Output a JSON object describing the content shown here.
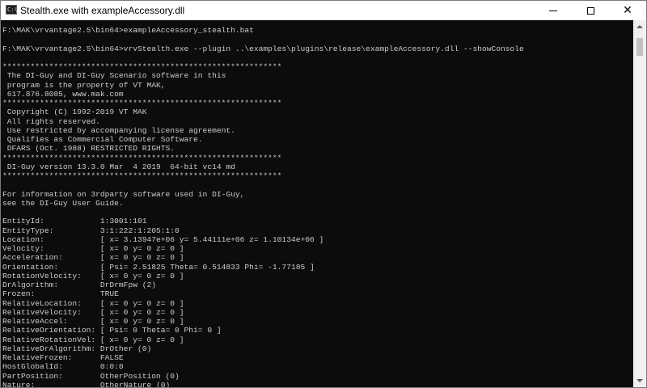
{
  "window": {
    "title": "Stealth.exe with exampleAccessory.dll",
    "icon_label": "C:\\",
    "minimize_icon": "minimize-icon",
    "maximize_icon": "maximize-icon",
    "close_icon": "close-icon",
    "close_glyph": "✕"
  },
  "console": {
    "lines": [
      "F:\\MAK\\vrvantage2.5\\bin64>exampleAccessory_stealth.bat",
      "",
      "F:\\MAK\\vrvantage2.5\\bin64>vrvStealth.exe --plugin ..\\examples\\plugins\\release\\exampleAccessory.dll --showConsole",
      "",
      "************************************************************",
      " The DI-Guy and DI-Guy Scenario software in this",
      " program is the property of VT MAK,",
      " 617.876.8085, www.mak.com",
      "************************************************************",
      " Copyright (C) 1992-2019 VT MAK",
      " All rights reserved.",
      " Use restricted by accompanying license agreement.",
      " Qualifies as Commercial Computer Software.",
      " DFARS (Oct. 1988) RESTRICTED RIGHTS.",
      "************************************************************",
      " DI-Guy version 13.3.0 Mar  4 2019  64-bit vc14 md",
      "************************************************************",
      "",
      "For information on 3rdparty software used in DI-Guy,",
      "see the DI-Guy User Guide.",
      "",
      "EntityId:            1:3001:101",
      "EntityType:          3:1:222:1:205:1:0",
      "Location:            [ x= 3.13947e+06 y= 5.44111e+06 z= 1.10134e+06 ]",
      "Velocity:            [ x= 0 y= 0 z= 0 ]",
      "Acceleration:        [ x= 0 y= 0 z= 0 ]",
      "Orientation:         [ Psi= 2.51825 Theta= 0.514833 Phi= -1.77185 ]",
      "RotationVelocity:    [ x= 0 y= 0 z= 0 ]",
      "DrAlgorithm:         DrDrmFpw (2)",
      "Frozen:              TRUE",
      "RelativeLocation:    [ x= 0 y= 0 z= 0 ]",
      "RelativeVelocity:    [ x= 0 y= 0 z= 0 ]",
      "RelativeAccel:       [ x= 0 y= 0 z= 0 ]",
      "RelativeOrientation: [ Psi= 0 Theta= 0 Phi= 0 ]",
      "RelativeRotationVel: [ x= 0 y= 0 z= 0 ]",
      "RelativeDrAlgorithm: DrOther (0)",
      "RelativeFrozen:      FALSE",
      "HostGlobalId:        0:0:0",
      "PartPosition:        OtherPosition (0)",
      "Nature:              OtherNature (0)"
    ]
  },
  "scrollbar": {
    "up_icon": "arrow-up-icon",
    "down_icon": "arrow-down-icon"
  }
}
